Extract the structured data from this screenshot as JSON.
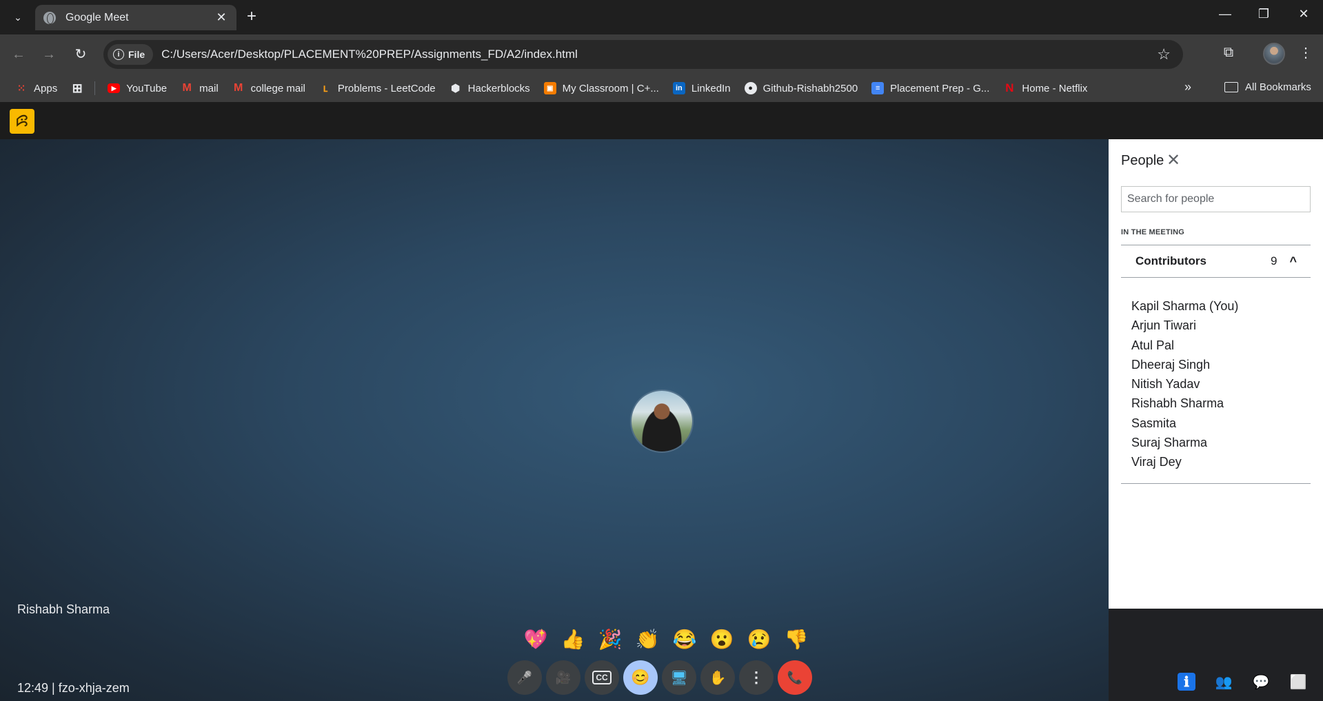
{
  "browser": {
    "tab_title": "Google Meet",
    "tab_close": "✕",
    "new_tab": "+",
    "file_chip": "File",
    "url": "C:/Users/Acer/Desktop/PLACEMENT%20PREP/Assignments_FD/A2/index.html",
    "bookmarks": [
      {
        "label": "Apps",
        "icon": "apps-grid-icon",
        "color": "#ea4335"
      },
      {
        "label": "YouTube",
        "icon": "youtube-icon",
        "color": "#ff0000"
      },
      {
        "label": "mail",
        "icon": "gmail-icon",
        "color": "#ea4335"
      },
      {
        "label": "college mail",
        "icon": "gmail-icon",
        "color": "#ea4335"
      },
      {
        "label": "Problems - LeetCode",
        "icon": "leetcode-icon",
        "color": "#ffa116"
      },
      {
        "label": "Hackerblocks",
        "icon": "hackerblocks-icon",
        "color": "#e8eaed"
      },
      {
        "label": "My Classroom | C+...",
        "icon": "classroom-icon",
        "color": "#f57c00"
      },
      {
        "label": "LinkedIn",
        "icon": "linkedin-icon",
        "color": "#0a66c2"
      },
      {
        "label": "Github-Rishabh2500",
        "icon": "github-icon",
        "color": "#e8eaed"
      },
      {
        "label": "Placement Prep - G...",
        "icon": "docs-icon",
        "color": "#4285f4"
      },
      {
        "label": "Home - Netflix",
        "icon": "netflix-icon",
        "color": "#e50914"
      }
    ],
    "bookmarks_more": "»",
    "all_bookmarks": "All Bookmarks"
  },
  "meet": {
    "logo_glyph": "ꕸ",
    "participant_name": "Rishabh Sharma",
    "clock_and_code": "12:49 | fzo-xhja-zem",
    "reactions": [
      "💖",
      "👍",
      "🎉",
      "👏",
      "😂",
      "😮",
      "😢",
      "👎"
    ],
    "controls": [
      {
        "name": "microphone-button",
        "icon": "🎤"
      },
      {
        "name": "camera-button",
        "icon": "🎥"
      },
      {
        "name": "captions-button",
        "icon": "CC"
      },
      {
        "name": "emoji-reactions-button",
        "icon": "😊",
        "active": true
      },
      {
        "name": "present-screen-button",
        "icon": "🖥"
      },
      {
        "name": "raise-hand-button",
        "icon": "✋"
      },
      {
        "name": "more-options-button",
        "icon": "⋮"
      },
      {
        "name": "leave-call-button",
        "icon": "📞",
        "end": true
      }
    ],
    "right_icons": [
      {
        "name": "meeting-details-button",
        "icon": "ℹ",
        "color": "#1a73e8"
      },
      {
        "name": "people-button",
        "icon": "👥",
        "color": "#6b5b95"
      },
      {
        "name": "chat-button",
        "icon": "💬",
        "color": "#e8eaed"
      },
      {
        "name": "activities-button",
        "icon": "⬜",
        "color": "#e8eaed"
      }
    ]
  },
  "people_panel": {
    "title": "People",
    "close": "✕",
    "search_placeholder": "Search for people",
    "section_label": "IN THE MEETING",
    "contributors_label": "Contributors",
    "contributors_count": "9",
    "chevron": "^",
    "participants": [
      "Kapil Sharma (You)",
      "Arjun Tiwari",
      "Atul Pal",
      "Dheeraj Singh",
      "Nitish Yadav",
      "Rishabh Sharma",
      "Sasmita",
      "Suraj Sharma",
      "Viraj Dey"
    ]
  }
}
